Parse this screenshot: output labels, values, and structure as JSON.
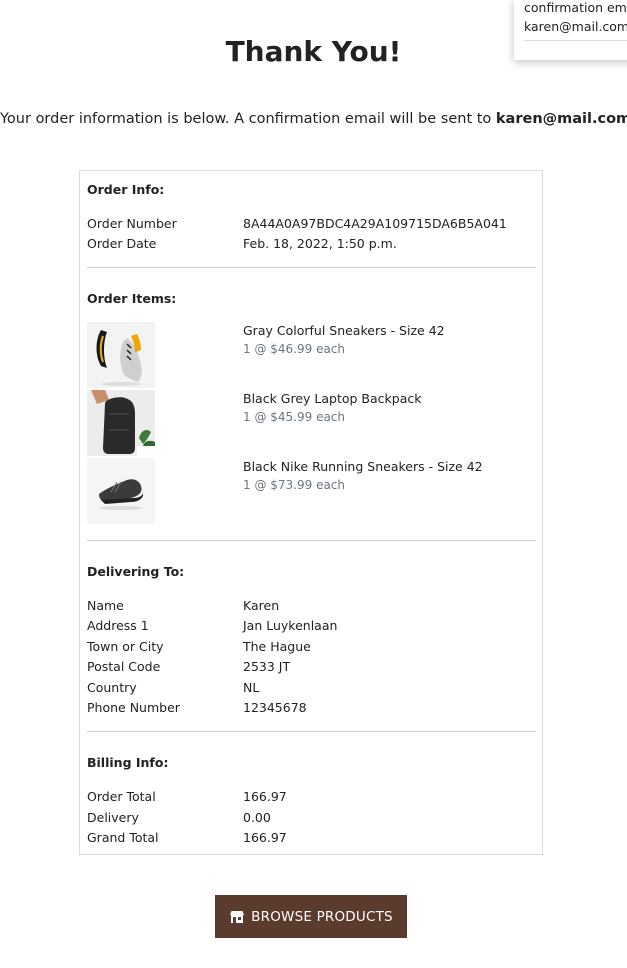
{
  "toast": {
    "line1": "confirmation email",
    "line2": "karen@mail.com."
  },
  "page": {
    "title": "Thank You!",
    "lead_text": "Your order information is below. A confirmation email will be sent to ",
    "lead_email": "karen@mail.com",
    "lead_end": "."
  },
  "order_info": {
    "heading": "Order Info:",
    "order_number_label": "Order Number",
    "order_number": "8A44A0A97BDC4A29A109715DA6B5A041",
    "order_date_label": "Order Date",
    "order_date": "Feb. 18, 2022, 1:50 p.m."
  },
  "order_items": {
    "heading": "Order Items:",
    "items": [
      {
        "name": "Gray Colorful Sneakers - Size 42",
        "qty": "1 @ $46.99 each",
        "icon": "sneaker-gray-image"
      },
      {
        "name": "Black Grey Laptop Backpack",
        "qty": "1 @ $45.99 each",
        "icon": "backpack-image"
      },
      {
        "name": "Black Nike Running Sneakers - Size 42",
        "qty": "1 @ $73.99 each",
        "icon": "sneaker-black-image"
      }
    ]
  },
  "delivery": {
    "heading": "Delivering To:",
    "rows": [
      {
        "label": "Name",
        "value": "Karen"
      },
      {
        "label": "Address 1",
        "value": "Jan Luykenlaan"
      },
      {
        "label": "Town or City",
        "value": "The Hague"
      },
      {
        "label": "Postal Code",
        "value": "2533 JT"
      },
      {
        "label": "Country",
        "value": "NL"
      },
      {
        "label": "Phone Number",
        "value": "12345678"
      }
    ]
  },
  "billing": {
    "heading": "Billing Info:",
    "rows": [
      {
        "label": "Order Total",
        "value": "166.97"
      },
      {
        "label": "Delivery",
        "value": "0.00"
      },
      {
        "label": "Grand Total",
        "value": "166.97"
      }
    ]
  },
  "actions": {
    "browse_label": "Browse Products",
    "browse_icon": "store-icon"
  },
  "colors": {
    "button_bg": "#5a3b2e",
    "muted_text": "#6c757d",
    "border": "#dddddd"
  }
}
